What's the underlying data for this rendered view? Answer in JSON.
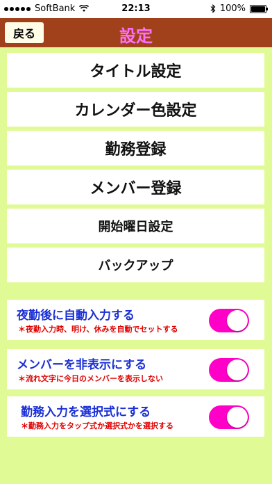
{
  "status_bar": {
    "carrier": "SoftBank",
    "time": "22:13",
    "battery": "100%",
    "battery_level": 1.0,
    "wifi_icon": "wifi-icon",
    "bluetooth_icon": "bluetooth-icon"
  },
  "nav": {
    "back_label": "戻る",
    "title": "設定"
  },
  "menu": {
    "items": [
      {
        "label": "タイトル設定"
      },
      {
        "label": "カレンダー色設定"
      },
      {
        "label": "勤務登録"
      },
      {
        "label": "メンバー登録"
      },
      {
        "label": "開始曜日設定"
      },
      {
        "label": "バックアップ"
      }
    ]
  },
  "toggles": [
    {
      "title": "夜勤後に自動入力する",
      "subtitle": "＊夜勤入力時、明け、休みを自動でセットする",
      "on": true
    },
    {
      "title": "メンバーを非表示にする",
      "subtitle": "＊流れ文字に今日のメンバーを表示しない",
      "on": true
    },
    {
      "title": "勤務入力を選択式にする",
      "subtitle": "＊勤務入力をタップ式か選択式かを選択する",
      "on": true
    }
  ],
  "colors": {
    "background": "#e0fa96",
    "navbar": "#a0411b",
    "title": "#ff6fff",
    "toggle_on": "#ff00c8",
    "toggle_title": "#1a2fd6",
    "toggle_sub": "#e00000"
  }
}
